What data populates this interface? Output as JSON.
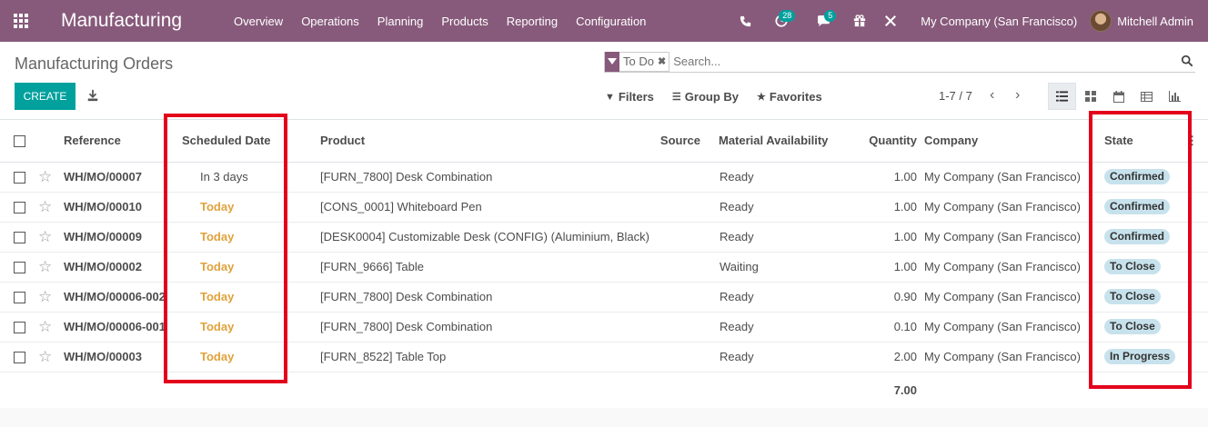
{
  "navbar": {
    "app_title": "Manufacturing",
    "menu": [
      "Overview",
      "Operations",
      "Planning",
      "Products",
      "Reporting",
      "Configuration"
    ],
    "activity_badge": "28",
    "messages_badge": "5",
    "company": "My Company (San Francisco)",
    "user": "Mitchell Admin",
    "background_color": "#875a7b"
  },
  "control": {
    "title": "Manufacturing Orders",
    "facet_label": "To Do",
    "search_placeholder": "Search...",
    "create_label": "CREATE",
    "filters_label": "Filters",
    "groupby_label": "Group By",
    "favorites_label": "Favorites",
    "pager": "1-7 / 7"
  },
  "table": {
    "columns": [
      "Reference",
      "Scheduled Date",
      "Product",
      "Source",
      "Material Availability",
      "Quantity",
      "Company",
      "State"
    ],
    "rows": [
      {
        "ref": "WH/MO/00007",
        "date": "In 3 days",
        "product": "[FURN_7800] Desk Combination",
        "source": "",
        "availability": "Ready",
        "qty": "1.00",
        "company": "My Company (San Francisco)",
        "state": "Confirmed"
      },
      {
        "ref": "WH/MO/00010",
        "date": "Today",
        "product": "[CONS_0001] Whiteboard Pen",
        "source": "",
        "availability": "Ready",
        "qty": "1.00",
        "company": "My Company (San Francisco)",
        "state": "Confirmed"
      },
      {
        "ref": "WH/MO/00009",
        "date": "Today",
        "product": "[DESK0004] Customizable Desk (CONFIG) (Aluminium, Black)",
        "source": "",
        "availability": "Ready",
        "qty": "1.00",
        "company": "My Company (San Francisco)",
        "state": "Confirmed"
      },
      {
        "ref": "WH/MO/00002",
        "date": "Today",
        "product": "[FURN_9666] Table",
        "source": "",
        "availability": "Waiting",
        "qty": "1.00",
        "company": "My Company (San Francisco)",
        "state": "To Close"
      },
      {
        "ref": "WH/MO/00006-002",
        "date": "Today",
        "product": "[FURN_7800] Desk Combination",
        "source": "",
        "availability": "Ready",
        "qty": "0.90",
        "company": "My Company (San Francisco)",
        "state": "To Close"
      },
      {
        "ref": "WH/MO/00006-001",
        "date": "Today",
        "product": "[FURN_7800] Desk Combination",
        "source": "",
        "availability": "Ready",
        "qty": "0.10",
        "company": "My Company (San Francisco)",
        "state": "To Close"
      },
      {
        "ref": "WH/MO/00003",
        "date": "Today",
        "product": "[FURN_8522] Table Top",
        "source": "",
        "availability": "Ready",
        "qty": "2.00",
        "company": "My Company (San Francisco)",
        "state": "In Progress"
      }
    ],
    "total_qty": "7.00"
  },
  "colors": {
    "accent": "#00a09d",
    "today": "#e0a23b",
    "badge": "#c7e2ec",
    "highlight": "#e3001b"
  }
}
